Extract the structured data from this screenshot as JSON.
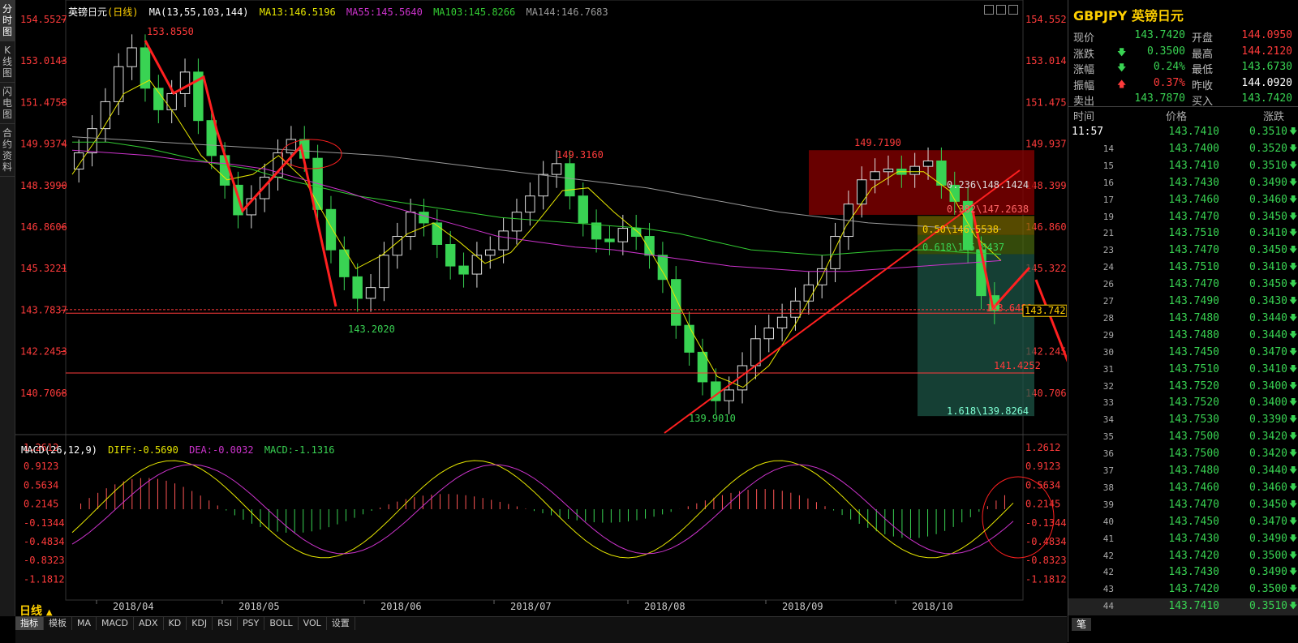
{
  "window": {
    "title": "英镑日元",
    "period": "日线"
  },
  "side_tabs": [
    "分时图",
    "K线图",
    "闪电图",
    "合约资料"
  ],
  "ma_header": {
    "symbol": "英镑日元",
    "period_bracket": "(日线)",
    "params": "MA(13,55,103,144)",
    "ma13": "MA13:146.5196",
    "ma55": "MA55:145.5640",
    "ma103": "MA103:145.8266",
    "ma144": "MA144:146.7683"
  },
  "macd_header": {
    "params": "MACD(26,12,9)",
    "diff": "DIFF:-0.5690",
    "dea": "DEA:-0.0032",
    "macd": "MACD:-1.1316"
  },
  "price_axis": [
    "154.5527",
    "153.0143",
    "151.4758",
    "149.9374",
    "148.3990",
    "146.8606",
    "145.3221",
    "143.7837",
    "142.2453",
    "140.7068"
  ],
  "macd_axis": [
    "1.2612",
    "0.9123",
    "0.5634",
    "0.2145",
    "-0.1344",
    "-0.4834",
    "-0.8323",
    "-1.1812"
  ],
  "date_axis": [
    "2018/04",
    "2018/05",
    "2018/06",
    "2018/07",
    "2018/08",
    "2018/09",
    "2018/10"
  ],
  "annotations": {
    "high1": "153.8550",
    "low1": "143.2020",
    "high2": "149.3160",
    "low2": "139.9010",
    "high3": "149.7190",
    "fib236": "0.236\\148.1424",
    "fib382": "0.382\\147.2638",
    "fib50": "0.50\\146.5538",
    "fib618": "0.618\\145.8437",
    "fib_base": "143.6481",
    "fib1618": "1.618\\139.8264",
    "level_141": "141.4252",
    "level_1437": "143.7837",
    "current_price": "143.7420"
  },
  "bottom_tabs": [
    "指标",
    "模板",
    "MA",
    "MACD",
    "ADX",
    "KD",
    "KDJ",
    "RSI",
    "PSY",
    "BOLL",
    "VOL",
    "设置"
  ],
  "quote": {
    "title": "GBPJPY 英镑日元",
    "rows": [
      {
        "l1": "现价",
        "v1": "143.7420",
        "c1": "dn",
        "l2": "开盘",
        "v2": "144.0950",
        "c2": "up"
      },
      {
        "l1": "涨跌",
        "v1": "0.3500",
        "c1": "dn",
        "a1": "down",
        "l2": "最高",
        "v2": "144.2120",
        "c2": "up"
      },
      {
        "l1": "涨幅",
        "v1": "0.24%",
        "c1": "dn",
        "a1": "down",
        "l2": "最低",
        "v2": "143.6730",
        "c2": "dn"
      },
      {
        "l1": "振幅",
        "v1": "0.37%",
        "c1": "up",
        "a1": "up",
        "l2": "昨收",
        "v2": "144.0920",
        "c2": "wht"
      },
      {
        "l1": "卖出",
        "v1": "143.7870",
        "c1": "dn",
        "l2": "买入",
        "v2": "143.7420",
        "c2": "dn"
      }
    ],
    "tick_headers": {
      "time": "时间",
      "price": "价格",
      "change": "涨跌"
    },
    "ticks": [
      {
        "t": "11:57",
        "p": "143.7410",
        "c": "0.3510"
      },
      {
        "t": "14",
        "p": "143.7400",
        "c": "0.3520"
      },
      {
        "t": "15",
        "p": "143.7410",
        "c": "0.3510"
      },
      {
        "t": "16",
        "p": "143.7430",
        "c": "0.3490"
      },
      {
        "t": "17",
        "p": "143.7460",
        "c": "0.3460"
      },
      {
        "t": "19",
        "p": "143.7470",
        "c": "0.3450"
      },
      {
        "t": "21",
        "p": "143.7510",
        "c": "0.3410"
      },
      {
        "t": "23",
        "p": "143.7470",
        "c": "0.3450"
      },
      {
        "t": "24",
        "p": "143.7510",
        "c": "0.3410"
      },
      {
        "t": "26",
        "p": "143.7470",
        "c": "0.3450"
      },
      {
        "t": "27",
        "p": "143.7490",
        "c": "0.3430"
      },
      {
        "t": "28",
        "p": "143.7480",
        "c": "0.3440"
      },
      {
        "t": "29",
        "p": "143.7480",
        "c": "0.3440"
      },
      {
        "t": "30",
        "p": "143.7450",
        "c": "0.3470"
      },
      {
        "t": "31",
        "p": "143.7510",
        "c": "0.3410"
      },
      {
        "t": "32",
        "p": "143.7520",
        "c": "0.3400"
      },
      {
        "t": "33",
        "p": "143.7520",
        "c": "0.3400"
      },
      {
        "t": "34",
        "p": "143.7530",
        "c": "0.3390"
      },
      {
        "t": "35",
        "p": "143.7500",
        "c": "0.3420"
      },
      {
        "t": "36",
        "p": "143.7500",
        "c": "0.3420"
      },
      {
        "t": "37",
        "p": "143.7480",
        "c": "0.3440"
      },
      {
        "t": "38",
        "p": "143.7460",
        "c": "0.3460"
      },
      {
        "t": "39",
        "p": "143.7470",
        "c": "0.3450"
      },
      {
        "t": "40",
        "p": "143.7450",
        "c": "0.3470"
      },
      {
        "t": "41",
        "p": "143.7430",
        "c": "0.3490"
      },
      {
        "t": "42",
        "p": "143.7420",
        "c": "0.3500"
      },
      {
        "t": "42",
        "p": "143.7430",
        "c": "0.3490"
      },
      {
        "t": "43",
        "p": "143.7420",
        "c": "0.3500"
      },
      {
        "t": "44",
        "p": "143.7410",
        "c": "0.3510"
      }
    ],
    "footer_tab": "笔"
  },
  "colors": {
    "up": "#ff3b3b",
    "down": "#39d353",
    "ma13": "#e6e600",
    "ma55": "#33cc33",
    "ma103": "#cc33cc",
    "ma144": "#999999",
    "accent": "#ffd000"
  }
}
